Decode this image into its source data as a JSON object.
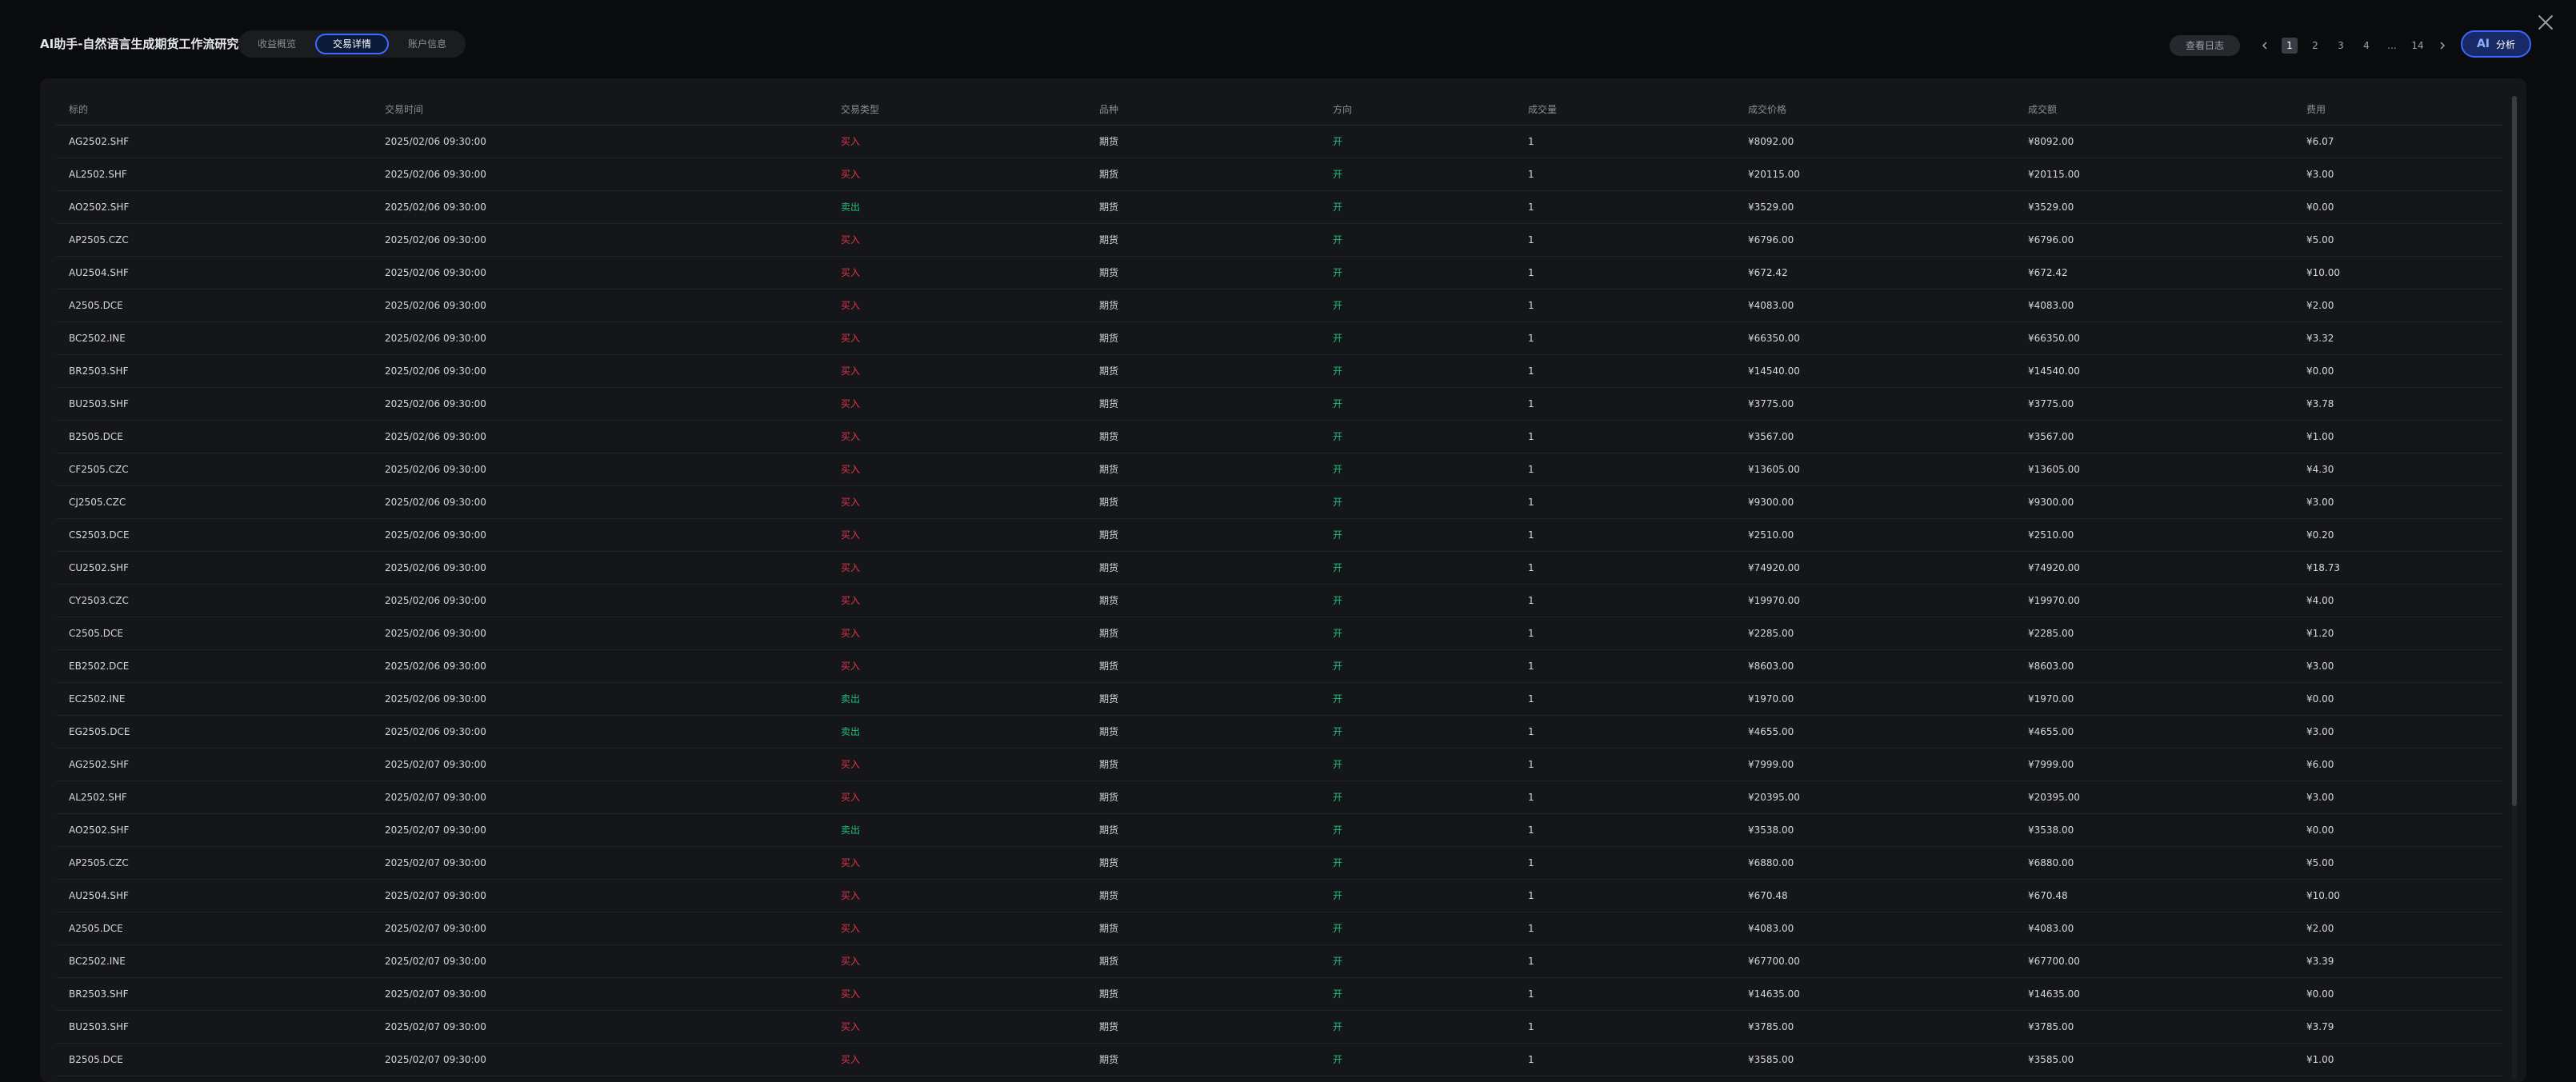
{
  "header": {
    "title": "AI助手-自然语言生成期货工作流研究",
    "tabs": [
      {
        "label": "收益概览",
        "active": false
      },
      {
        "label": "交易详情",
        "active": true
      },
      {
        "label": "账户信息",
        "active": false
      }
    ],
    "log_button": "查看日志",
    "pagination": {
      "pages": [
        "1",
        "2",
        "3",
        "4",
        "...",
        "14"
      ],
      "current": "1"
    },
    "ai_button": {
      "icon": "AI",
      "label": "分析"
    }
  },
  "colors": {
    "buy": "#e0364a",
    "sell": "#1fbf7a",
    "accent": "#3b66ff"
  },
  "table": {
    "columns": [
      "标的",
      "交易时间",
      "交易类型",
      "品种",
      "方向",
      "成交量",
      "成交价格",
      "成交额",
      "费用"
    ],
    "rows": [
      [
        "AG2502.SHF",
        "2025/02/06 09:30:00",
        "买入",
        "期货",
        "开",
        "1",
        "¥8092.00",
        "¥8092.00",
        "¥6.07"
      ],
      [
        "AL2502.SHF",
        "2025/02/06 09:30:00",
        "买入",
        "期货",
        "开",
        "1",
        "¥20115.00",
        "¥20115.00",
        "¥3.00"
      ],
      [
        "AO2502.SHF",
        "2025/02/06 09:30:00",
        "卖出",
        "期货",
        "开",
        "1",
        "¥3529.00",
        "¥3529.00",
        "¥0.00"
      ],
      [
        "AP2505.CZC",
        "2025/02/06 09:30:00",
        "买入",
        "期货",
        "开",
        "1",
        "¥6796.00",
        "¥6796.00",
        "¥5.00"
      ],
      [
        "AU2504.SHF",
        "2025/02/06 09:30:00",
        "买入",
        "期货",
        "开",
        "1",
        "¥672.42",
        "¥672.42",
        "¥10.00"
      ],
      [
        "A2505.DCE",
        "2025/02/06 09:30:00",
        "买入",
        "期货",
        "开",
        "1",
        "¥4083.00",
        "¥4083.00",
        "¥2.00"
      ],
      [
        "BC2502.INE",
        "2025/02/06 09:30:00",
        "买入",
        "期货",
        "开",
        "1",
        "¥66350.00",
        "¥66350.00",
        "¥3.32"
      ],
      [
        "BR2503.SHF",
        "2025/02/06 09:30:00",
        "买入",
        "期货",
        "开",
        "1",
        "¥14540.00",
        "¥14540.00",
        "¥0.00"
      ],
      [
        "BU2503.SHF",
        "2025/02/06 09:30:00",
        "买入",
        "期货",
        "开",
        "1",
        "¥3775.00",
        "¥3775.00",
        "¥3.78"
      ],
      [
        "B2505.DCE",
        "2025/02/06 09:30:00",
        "买入",
        "期货",
        "开",
        "1",
        "¥3567.00",
        "¥3567.00",
        "¥1.00"
      ],
      [
        "CF2505.CZC",
        "2025/02/06 09:30:00",
        "买入",
        "期货",
        "开",
        "1",
        "¥13605.00",
        "¥13605.00",
        "¥4.30"
      ],
      [
        "CJ2505.CZC",
        "2025/02/06 09:30:00",
        "买入",
        "期货",
        "开",
        "1",
        "¥9300.00",
        "¥9300.00",
        "¥3.00"
      ],
      [
        "CS2503.DCE",
        "2025/02/06 09:30:00",
        "买入",
        "期货",
        "开",
        "1",
        "¥2510.00",
        "¥2510.00",
        "¥0.20"
      ],
      [
        "CU2502.SHF",
        "2025/02/06 09:30:00",
        "买入",
        "期货",
        "开",
        "1",
        "¥74920.00",
        "¥74920.00",
        "¥18.73"
      ],
      [
        "CY2503.CZC",
        "2025/02/06 09:30:00",
        "买入",
        "期货",
        "开",
        "1",
        "¥19970.00",
        "¥19970.00",
        "¥4.00"
      ],
      [
        "C2505.DCE",
        "2025/02/06 09:30:00",
        "买入",
        "期货",
        "开",
        "1",
        "¥2285.00",
        "¥2285.00",
        "¥1.20"
      ],
      [
        "EB2502.DCE",
        "2025/02/06 09:30:00",
        "买入",
        "期货",
        "开",
        "1",
        "¥8603.00",
        "¥8603.00",
        "¥3.00"
      ],
      [
        "EC2502.INE",
        "2025/02/06 09:30:00",
        "卖出",
        "期货",
        "开",
        "1",
        "¥1970.00",
        "¥1970.00",
        "¥0.00"
      ],
      [
        "EG2505.DCE",
        "2025/02/06 09:30:00",
        "卖出",
        "期货",
        "开",
        "1",
        "¥4655.00",
        "¥4655.00",
        "¥3.00"
      ],
      [
        "AG2502.SHF",
        "2025/02/07 09:30:00",
        "买入",
        "期货",
        "开",
        "1",
        "¥7999.00",
        "¥7999.00",
        "¥6.00"
      ],
      [
        "AL2502.SHF",
        "2025/02/07 09:30:00",
        "买入",
        "期货",
        "开",
        "1",
        "¥20395.00",
        "¥20395.00",
        "¥3.00"
      ],
      [
        "AO2502.SHF",
        "2025/02/07 09:30:00",
        "卖出",
        "期货",
        "开",
        "1",
        "¥3538.00",
        "¥3538.00",
        "¥0.00"
      ],
      [
        "AP2505.CZC",
        "2025/02/07 09:30:00",
        "买入",
        "期货",
        "开",
        "1",
        "¥6880.00",
        "¥6880.00",
        "¥5.00"
      ],
      [
        "AU2504.SHF",
        "2025/02/07 09:30:00",
        "买入",
        "期货",
        "开",
        "1",
        "¥670.48",
        "¥670.48",
        "¥10.00"
      ],
      [
        "A2505.DCE",
        "2025/02/07 09:30:00",
        "买入",
        "期货",
        "开",
        "1",
        "¥4083.00",
        "¥4083.00",
        "¥2.00"
      ],
      [
        "BC2502.INE",
        "2025/02/07 09:30:00",
        "买入",
        "期货",
        "开",
        "1",
        "¥67700.00",
        "¥67700.00",
        "¥3.39"
      ],
      [
        "BR2503.SHF",
        "2025/02/07 09:30:00",
        "买入",
        "期货",
        "开",
        "1",
        "¥14635.00",
        "¥14635.00",
        "¥0.00"
      ],
      [
        "BU2503.SHF",
        "2025/02/07 09:30:00",
        "买入",
        "期货",
        "开",
        "1",
        "¥3785.00",
        "¥3785.00",
        "¥3.79"
      ],
      [
        "B2505.DCE",
        "2025/02/07 09:30:00",
        "买入",
        "期货",
        "开",
        "1",
        "¥3585.00",
        "¥3585.00",
        "¥1.00"
      ]
    ]
  }
}
